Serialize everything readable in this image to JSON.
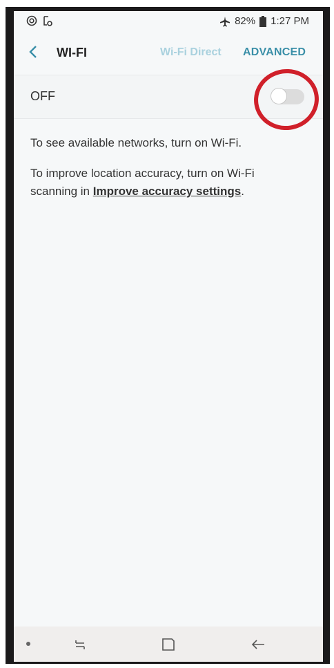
{
  "status_bar": {
    "battery": "82%",
    "time": "1:27 PM"
  },
  "app_bar": {
    "title": "WI-FI",
    "wifi_direct": "Wi-Fi Direct",
    "advanced": "ADVANCED"
  },
  "wifi_toggle": {
    "label": "OFF",
    "state": "off"
  },
  "info": {
    "text1": "To see available networks, turn on Wi-Fi.",
    "text2_prefix": "To improve location accuracy, turn on Wi-Fi scanning in ",
    "text2_link": "Improve accuracy settings",
    "text2_suffix": "."
  },
  "colors": {
    "accent": "#3a8fa8",
    "accent_disabled": "#a9d1de",
    "annotation": "#d0202a"
  }
}
